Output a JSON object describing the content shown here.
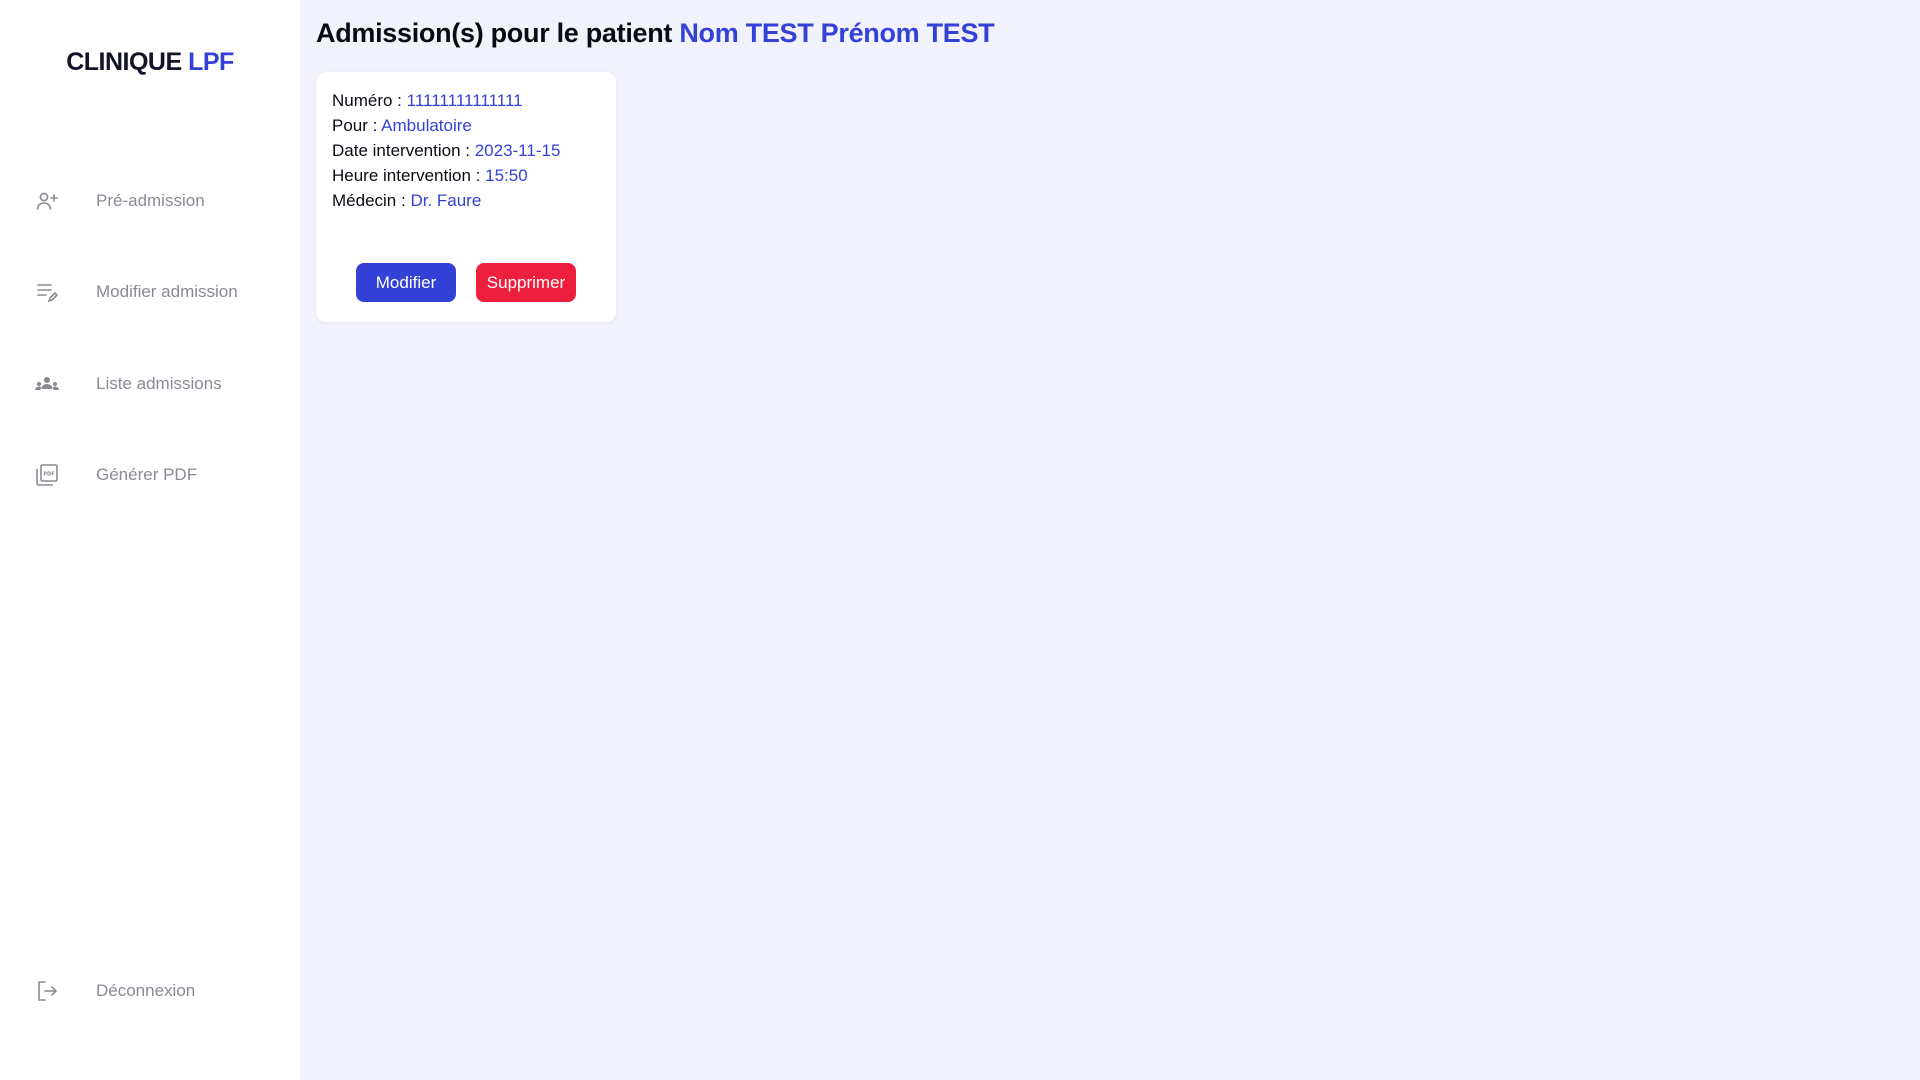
{
  "brand": {
    "name": "CLINIQUE",
    "accent": "LPF"
  },
  "nav": {
    "items": [
      {
        "label": "Pré-admission",
        "icon": "user-plus-icon"
      },
      {
        "label": "Modifier admission",
        "icon": "list-edit-icon"
      },
      {
        "label": "Liste admissions",
        "icon": "group-icon"
      },
      {
        "label": "Générer PDF",
        "icon": "pdf-file-icon"
      }
    ],
    "logout": {
      "label": "Déconnexion",
      "icon": "logout-icon"
    }
  },
  "page": {
    "title_prefix": "Admission(s) pour le patient",
    "patient_name": "Nom TEST Prénom TEST"
  },
  "admission": {
    "numero_label": "Numéro :",
    "numero": "11111111111111",
    "pour_label": "Pour :",
    "pour": "Ambulatoire",
    "date_label": "Date intervention :",
    "date": "2023-11-15",
    "heure_label": "Heure intervention :",
    "heure": "15:50",
    "medecin_label": "Médecin :",
    "medecin": "Dr. Faure",
    "modify_label": "Modifier",
    "delete_label": "Supprimer"
  },
  "colors": {
    "accent": "#3441d6",
    "danger": "#ee1f3c",
    "background": "#f1f2fb",
    "muted_text": "#8a8a94"
  }
}
